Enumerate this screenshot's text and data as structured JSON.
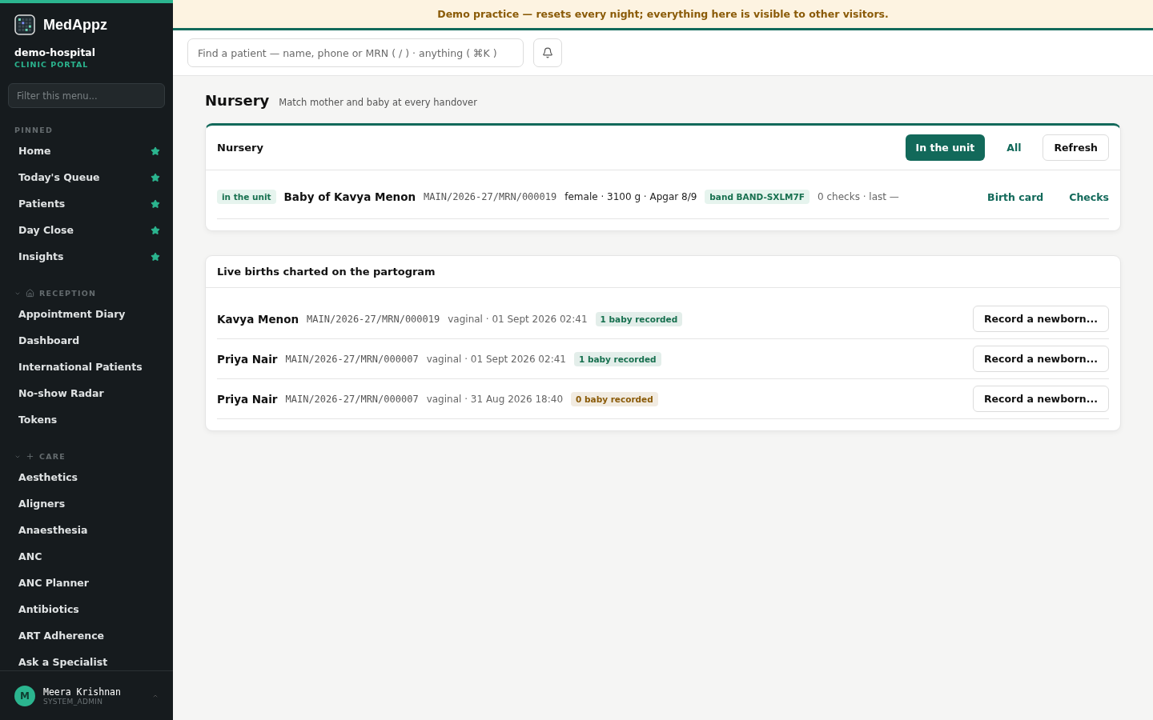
{
  "brand": {
    "name": "MedAppz",
    "org": "demo-hospital",
    "portal": "CLINIC PORTAL"
  },
  "sidebar": {
    "filter_placeholder": "Filter this menu...",
    "pinned": {
      "label": "PINNED",
      "items": [
        {
          "label": "Home",
          "starred": true
        },
        {
          "label": "Today's Queue",
          "starred": true
        },
        {
          "label": "Patients",
          "starred": true
        },
        {
          "label": "Day Close",
          "starred": true
        },
        {
          "label": "Insights",
          "starred": true
        }
      ]
    },
    "groups": [
      {
        "label": "RECEPTION",
        "kind": "house",
        "expanded": true,
        "items": [
          "Appointment Diary",
          "Dashboard",
          "International Patients",
          "No-show Radar",
          "Tokens"
        ]
      },
      {
        "label": "CARE",
        "kind": "plus",
        "expanded": true,
        "items": [
          "Aesthetics",
          "Aligners",
          "Anaesthesia",
          "ANC",
          "ANC Planner",
          "Antibiotics",
          "ART Adherence",
          "Ask a Specialist"
        ]
      }
    ],
    "user": {
      "initial": "M",
      "name": "Meera Krishnan",
      "role": "SYSTEM_ADMIN"
    }
  },
  "banner": "Demo practice — resets every night; everything here is visible to other visitors.",
  "search": {
    "placeholder": "Find a patient — name, phone or MRN ( / ) · anything ( ⌘K )"
  },
  "page": {
    "title": "Nursery",
    "subtitle": "Match mother and baby at every handover"
  },
  "nursery": {
    "title": "Nursery",
    "filters": [
      {
        "label": "In the unit",
        "selected": true
      },
      {
        "label": "All",
        "selected": false
      }
    ],
    "refresh": "Refresh",
    "rows": [
      {
        "status": "in the unit",
        "name": "Baby of Kavya Menon",
        "mrn": "MAIN/2026-27/MRN/000019",
        "details": "female · 3100 g · Apgar 8/9",
        "band": "band BAND-SXLM7F",
        "checks": "0 checks · last —",
        "actions": [
          "Birth card",
          "Checks"
        ]
      }
    ]
  },
  "births": {
    "title": "Live births charted on the partogram",
    "rows": [
      {
        "name": "Kavya Menon",
        "mrn": "MAIN/2026-27/MRN/000019",
        "details": "vaginal · 01 Sept 2026 02:41",
        "badge": "1 baby recorded",
        "color": "#17704f",
        "action": "Record a newborn..."
      },
      {
        "name": "Priya Nair",
        "mrn": "MAIN/2026-27/MRN/000007",
        "details": "vaginal · 01 Sept 2026 02:41",
        "badge": "1 baby recorded",
        "color": "#17704f",
        "action": "Record a newborn..."
      },
      {
        "name": "Priya Nair",
        "mrn": "MAIN/2026-27/MRN/000007",
        "details": "vaginal · 31 Aug 2026 18:40",
        "badge": "0 baby recorded",
        "color": "#8a5a07",
        "action": "Record a newborn..."
      }
    ]
  }
}
